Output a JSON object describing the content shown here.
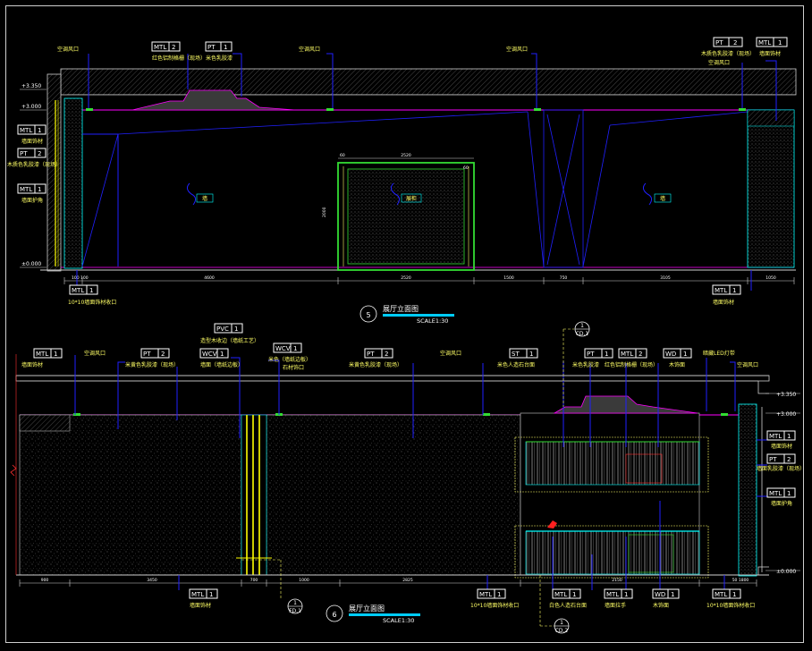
{
  "elevation5": {
    "number": "5",
    "title": "展厅立面图",
    "scale": "SCALE1:30",
    "levels": [
      "+3.350",
      "+3.000",
      "±0.000"
    ],
    "dims_top": [
      "2520",
      "60",
      "60",
      "2000"
    ],
    "dim_side": "2000",
    "dims_bottom": [
      "100 100",
      "4600",
      "2520",
      "1500",
      "750",
      "3105",
      "1050"
    ],
    "room_labels": [
      "墙",
      "展柜",
      "墙"
    ],
    "notes_top": [
      "空调风口",
      "红色铝制格栅（现场）",
      "米色乳胶漆",
      "空调风口",
      "空调风口",
      "木质色乳胶漆（现场）",
      "空调风口",
      "墙面饰材"
    ],
    "notes_left": [
      "墙面饰材",
      "木质色乳胶漆（现场）",
      "墙面护角"
    ],
    "notes_bottom": [
      "10*10墙面饰材收口",
      "墙面饰材"
    ],
    "tags_top": [
      {
        "code": "MTL",
        "num": "2"
      },
      {
        "code": "PT",
        "num": "1"
      },
      {
        "code": "PT",
        "num": "2"
      },
      {
        "code": "MTL",
        "num": "1"
      }
    ],
    "tags_left": [
      {
        "code": "MTL",
        "num": "1"
      },
      {
        "code": "PT",
        "num": "2"
      },
      {
        "code": "MTL",
        "num": "1"
      }
    ],
    "tags_bottom": [
      {
        "code": "MTL",
        "num": "1"
      },
      {
        "code": "MTL",
        "num": "1"
      }
    ]
  },
  "elevation6": {
    "number": "6",
    "title": "展厅立面图",
    "scale": "SCALE1:30",
    "levels": [
      "+3.350",
      "+3.000",
      "±0.000"
    ],
    "section_ref_top": {
      "num": "1",
      "sheet": "CD.1"
    },
    "section_ref_bottom": {
      "num": "1",
      "sheet": "CD.2"
    },
    "section_ref_left": {
      "num": "1",
      "sheet": "FD.1"
    },
    "dims_bottom": [
      "900",
      "3450",
      "700",
      "1000",
      "2825",
      "2150",
      "50 1800"
    ],
    "notes_top": [
      "墙面饰材",
      "空调风口",
      "米黄色乳胶漆（现场）",
      "造型木收边（墙纸工艺）",
      "墙面（墙纸边板）",
      "米色（墙纸边板）",
      "石材饰口",
      "米黄色乳胶漆（现场）",
      "空调风口",
      "米色人造石台面",
      "米色乳胶漆",
      "红色铝制格栅（现场）",
      "木饰面",
      "暗藏LED灯带",
      "空调风口"
    ],
    "notes_right": [
      "墙面饰材",
      "墙面乳胶漆（现场）",
      "墙面护角"
    ],
    "notes_bottom": [
      "墙面饰材",
      "10*10墙面饰材收口",
      "白色人造石台面",
      "墙面拉手",
      "木饰面",
      "10*10墙面饰材收口"
    ],
    "tags_top": [
      {
        "code": "PVC",
        "num": "1"
      },
      {
        "code": "MTL",
        "num": "1"
      },
      {
        "code": "PT",
        "num": "2"
      },
      {
        "code": "WCV",
        "num": "1"
      },
      {
        "code": "WCV",
        "num": "1"
      },
      {
        "code": "PT",
        "num": "2"
      },
      {
        "code": "ST",
        "num": "1"
      },
      {
        "code": "PT",
        "num": "1"
      },
      {
        "code": "MTL",
        "num": "2"
      },
      {
        "code": "WD",
        "num": "1"
      }
    ],
    "tags_right": [
      {
        "code": "MTL",
        "num": "1"
      },
      {
        "code": "PT",
        "num": "2"
      },
      {
        "code": "MTL",
        "num": "1"
      }
    ],
    "tags_bottom": [
      {
        "code": "MTL",
        "num": "1"
      },
      {
        "code": "MTL",
        "num": "1"
      },
      {
        "code": "MTL",
        "num": "1"
      },
      {
        "code": "MTL",
        "num": "1"
      },
      {
        "code": "WD",
        "num": "1"
      },
      {
        "code": "MTL",
        "num": "1"
      }
    ]
  }
}
